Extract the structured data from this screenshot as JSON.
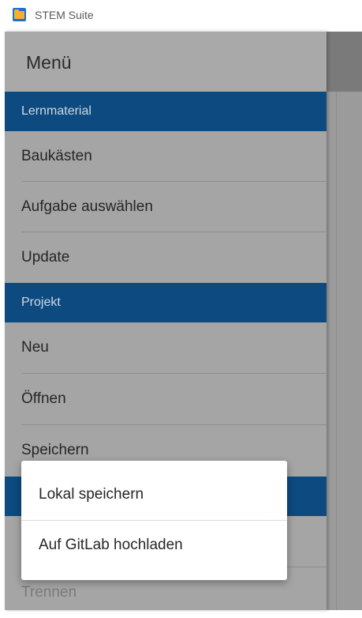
{
  "window": {
    "title": "STEM Suite"
  },
  "drawer": {
    "title": "Menü",
    "sections": [
      {
        "label": "Lernmaterial",
        "items": [
          "Baukästen",
          "Aufgabe auswählen",
          "Update"
        ]
      },
      {
        "label": "Projekt",
        "items": [
          "Neu",
          "Öffnen",
          "Speichern"
        ]
      }
    ],
    "bottom_item": "Trennen"
  },
  "popup": {
    "items": [
      "Lokal speichern",
      "Auf GitLab hochladen"
    ]
  },
  "colors": {
    "section_header": "#0c4a80",
    "scrim_drawer": "#a5a5a5"
  },
  "icons": {
    "app": "stem-suite-app-icon"
  }
}
